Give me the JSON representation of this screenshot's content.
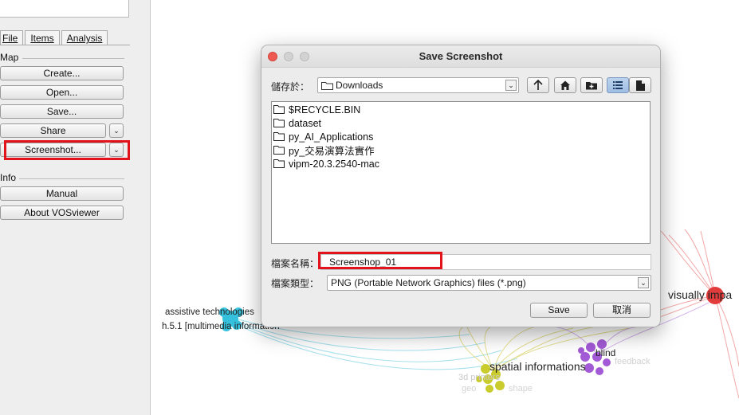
{
  "sidebar": {
    "tabs": [
      {
        "label": "File"
      },
      {
        "label": "Items"
      },
      {
        "label": "Analysis"
      }
    ],
    "map_section": "Map",
    "buttons": {
      "create": "Create...",
      "open": "Open...",
      "save": "Save...",
      "share": "Share",
      "screenshot": "Screenshot..."
    },
    "info_section": "Info",
    "info_buttons": {
      "manual": "Manual",
      "about": "About VOSviewer"
    }
  },
  "network": {
    "labels": {
      "assistive": "assistive technologies",
      "h51": "h.5.1 [multimedia information",
      "visually": "visually impa",
      "blind": "blind",
      "spatial": "spatial informations",
      "printers": "3d printers",
      "feedback": "feedback",
      "shape": "shape",
      "geo": "geo"
    },
    "colors": {
      "cyan": "#35c1dd",
      "red": "#e23b3b",
      "purple": "#a35ad6",
      "yellow": "#c9cc2c"
    }
  },
  "dialog": {
    "title": "Save Screenshot",
    "save_in_label": "儲存於：",
    "location": "Downloads",
    "files": [
      {
        "name": "$RECYCLE.BIN",
        "icon": "folder-icon"
      },
      {
        "name": "dataset",
        "icon": "folder-icon"
      },
      {
        "name": "py_AI_Applications",
        "icon": "folder-icon"
      },
      {
        "name": "py_交易演算法實作",
        "icon": "folder-icon"
      },
      {
        "name": "vipm-20.3.2540-mac",
        "icon": "folder-icon"
      }
    ],
    "filename_label": "檔案名稱：",
    "filename_value": "Screenshop_01",
    "filetype_label": "檔案類型：",
    "filetype_value": "PNG (Portable Network Graphics) files (*.png)",
    "save_button": "Save",
    "cancel_button": "取消",
    "toolbar_icons": [
      "up-folder-icon",
      "home-icon",
      "new-folder-icon",
      "list-view-icon",
      "details-view-icon"
    ]
  },
  "highlight_color": "#e1141c"
}
